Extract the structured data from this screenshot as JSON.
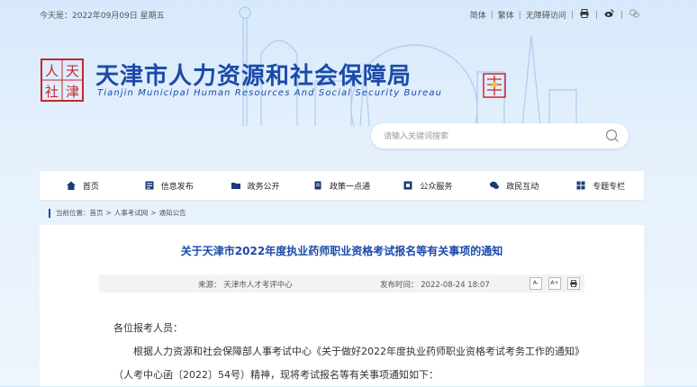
{
  "topbar": {
    "date_label": "今天是：2022年09月09日 星期五",
    "links": [
      "简体",
      "繁体",
      "无障碍访问"
    ],
    "icons": [
      "printer-icon",
      "weibo-icon",
      "wechat-icon"
    ]
  },
  "header": {
    "seal_chars": [
      "人",
      "天",
      "社",
      "津"
    ],
    "title_cn": "天津市人力资源和社会保障局",
    "title_en": "Tianjin Municipal Human Resources And Social Security Bureau",
    "brand_color": "#1b4aa8",
    "seal_color": "#c8262b"
  },
  "search": {
    "placeholder": "请输入关键词搜索"
  },
  "nav": {
    "items": [
      {
        "label": "首页",
        "icon": "home-icon"
      },
      {
        "label": "信息发布",
        "icon": "info-icon"
      },
      {
        "label": "政务公开",
        "icon": "folder-icon"
      },
      {
        "label": "政策一点通",
        "icon": "document-icon"
      },
      {
        "label": "公众服务",
        "icon": "service-icon"
      },
      {
        "label": "政民互动",
        "icon": "chat-icon"
      },
      {
        "label": "专题专栏",
        "icon": "grid-icon"
      }
    ]
  },
  "breadcrumb": {
    "prefix": "当前位置：",
    "items": [
      "首页",
      "人事考试网",
      "通知公告"
    ]
  },
  "article": {
    "title": "关于天津市2022年度执业药师职业资格考试报名等有关事项的通知",
    "source": "来源：  天津市人才考评中心",
    "published": "发布时间：  2022-08-24 18:07",
    "font_buttons": [
      "A-",
      "A+",
      "print"
    ],
    "salutation": "各位报考人员：",
    "paragraph": "根据人力资源和社会保障部人事考试中心《关于做好2022年度执业药师职业资格考试考务工作的通知》（人考中心函〔2022〕54号）精神，现将考试报名等有关事项通知如下："
  }
}
